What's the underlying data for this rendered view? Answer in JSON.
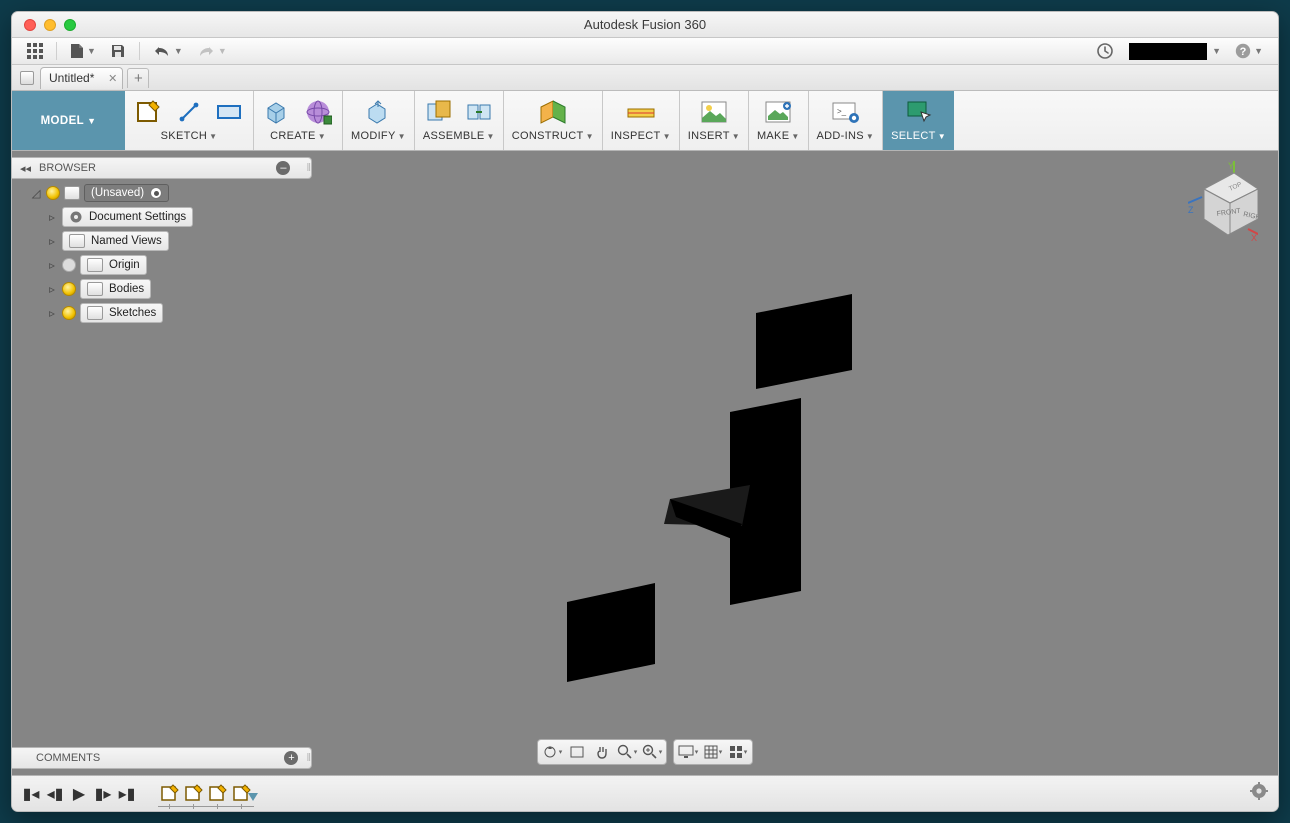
{
  "app": {
    "title": "Autodesk Fusion 360"
  },
  "tab": {
    "name": "Untitled*"
  },
  "workspace": {
    "name": "MODEL"
  },
  "ribbon": {
    "sketch": "SKETCH",
    "create": "CREATE",
    "modify": "MODIFY",
    "assemble": "ASSEMBLE",
    "construct": "CONSTRUCT",
    "inspect": "INSPECT",
    "insert": "INSERT",
    "make": "MAKE",
    "addins": "ADD-INS",
    "select": "SELECT"
  },
  "browser": {
    "title": "BROWSER",
    "root": "(Unsaved)",
    "items": [
      {
        "label": "Document Settings",
        "icon": "gear"
      },
      {
        "label": "Named Views",
        "icon": "folder"
      },
      {
        "label": "Origin",
        "icon": "folder",
        "bulbOff": true
      },
      {
        "label": "Bodies",
        "icon": "folder"
      },
      {
        "label": "Sketches",
        "icon": "folder"
      }
    ]
  },
  "comments": {
    "title": "COMMENTS"
  },
  "viewcube": {
    "front": "FRONT",
    "right": "RIGHT",
    "top": "TOP",
    "x": "X",
    "y": "Y",
    "z": "Z"
  }
}
